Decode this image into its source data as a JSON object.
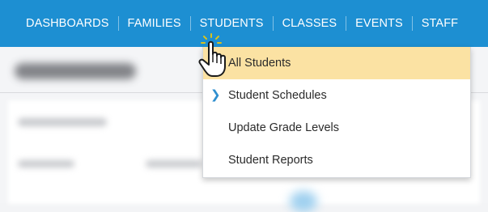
{
  "nav": {
    "items": [
      {
        "label": "DASHBOARDS"
      },
      {
        "label": "FAMILIES"
      },
      {
        "label": "STUDENTS"
      },
      {
        "label": "CLASSES"
      },
      {
        "label": "EVENTS"
      },
      {
        "label": "STAFF"
      }
    ],
    "active_item": "STUDENTS"
  },
  "dropdown": {
    "items": [
      {
        "label": "All Students",
        "highlighted": true
      },
      {
        "label": "Student Schedules",
        "has_submenu": true
      },
      {
        "label": "Update Grade Levels"
      },
      {
        "label": "Student Reports"
      }
    ]
  },
  "colors": {
    "nav_background": "#1d8fd2",
    "highlight": "#fbe2a3",
    "chevron": "#2f8fcf"
  },
  "icons": {
    "submenu": "chevron-right-icon",
    "pointer": "hand-pointer-icon"
  }
}
